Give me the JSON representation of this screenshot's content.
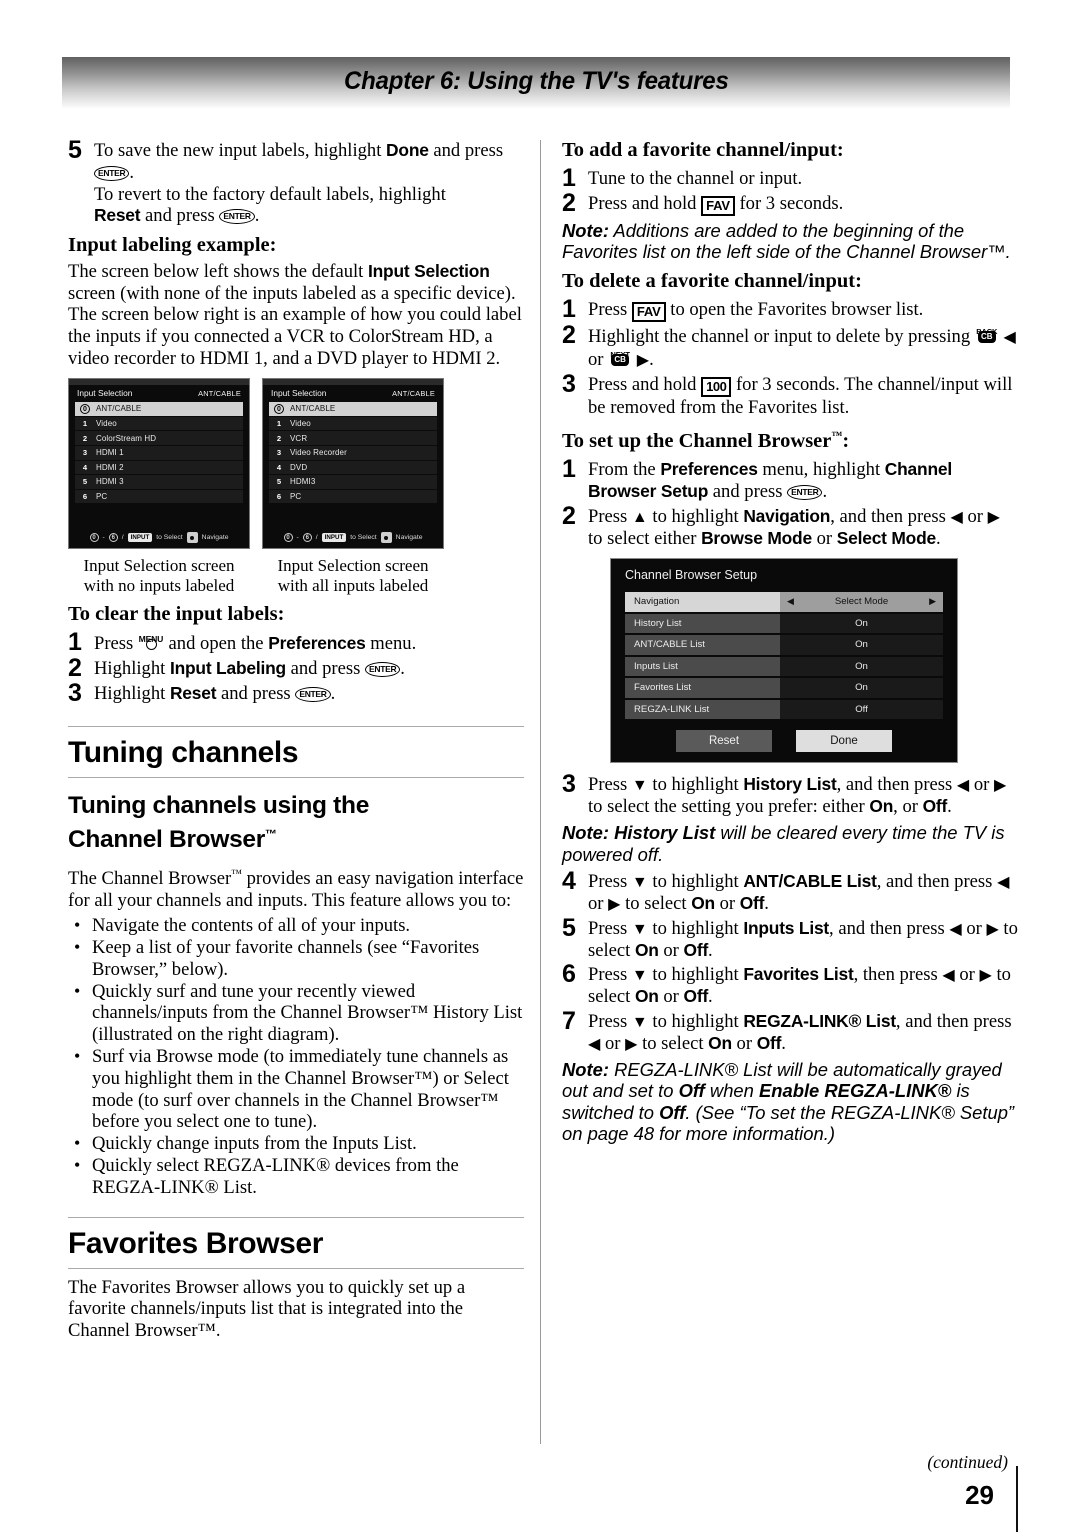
{
  "header": {
    "chapter_title": "Chapter 6: Using the TV's features"
  },
  "footer": {
    "continued": "(continued)",
    "page_number": "29"
  },
  "left_column": {
    "step5": {
      "num": "5",
      "line1_a": "To save the new input labels, highlight ",
      "line1_b": "Done",
      "line1_c": " and press ",
      "enter_key": "ENTER",
      "line2_a": "To revert to the factory default labels, highlight ",
      "line2_b": "Reset",
      "line2_c": " and press "
    },
    "input_labeling_example_heading": "Input labeling example:",
    "example_paragraph_a": "The screen below left shows the default ",
    "example_paragraph_b": "Input Selection",
    "example_paragraph_c": " screen (with none of the inputs labeled as a specific device). The screen below right is an example of how you could label the inputs if you connected a VCR to ColorStream HD, a video recorder to HDMI 1, and a DVD player to HDMI 2.",
    "osd_left": {
      "title": "Input Selection",
      "title_right": "ANT/CABLE",
      "items": [
        {
          "num": "0",
          "label": "ANT/CABLE",
          "selected": true
        },
        {
          "num": "1",
          "label": "Video",
          "selected": false
        },
        {
          "num": "2",
          "label": "ColorStream HD",
          "selected": false
        },
        {
          "num": "3",
          "label": "HDMI 1",
          "selected": false
        },
        {
          "num": "4",
          "label": "HDMI 2",
          "selected": false
        },
        {
          "num": "5",
          "label": "HDMI 3",
          "selected": false
        },
        {
          "num": "6",
          "label": "PC",
          "selected": false
        }
      ],
      "footer": {
        "range_from": "0",
        "dash": "-",
        "range_to": "6",
        "slash": "/",
        "input_key": "INPUT",
        "to_select": "to Select",
        "navigate": "Navigate"
      },
      "caption": "Input Selection screen with no inputs labeled"
    },
    "osd_right": {
      "title": "Input Selection",
      "title_right": "ANT/CABLE",
      "items": [
        {
          "num": "0",
          "label": "ANT/CABLE",
          "selected": true
        },
        {
          "num": "1",
          "label": "Video",
          "selected": false
        },
        {
          "num": "2",
          "label": "VCR",
          "selected": false
        },
        {
          "num": "3",
          "label": "Video Recorder",
          "selected": false
        },
        {
          "num": "4",
          "label": "DVD",
          "selected": false
        },
        {
          "num": "5",
          "label": "HDMI3",
          "selected": false
        },
        {
          "num": "6",
          "label": "PC",
          "selected": false
        }
      ],
      "footer": {
        "range_from": "0",
        "dash": "-",
        "range_to": "6",
        "slash": "/",
        "input_key": "INPUT",
        "to_select": "to Select",
        "navigate": "Navigate"
      },
      "caption": "Input Selection screen with all inputs labeled"
    },
    "clear_labels_heading": "To clear the input labels:",
    "clear_steps": {
      "s1_num": "1",
      "s1_a": "Press ",
      "s1_menu": "MENU",
      "s1_b": " and open the ",
      "s1_c": "Preferences",
      "s1_d": " menu.",
      "s2_num": "2",
      "s2_a": "Highlight ",
      "s2_b": "Input Labeling",
      "s2_c": " and press ",
      "s3_num": "3",
      "s3_a": "Highlight ",
      "s3_b": "Reset",
      "s3_c": " and press "
    },
    "tuning_channels_heading": "Tuning channels",
    "tuning_sub_heading_line1": "Tuning channels using the",
    "tuning_sub_heading_line2": "Channel Browser",
    "tm": "™",
    "cb_intro_a": "The Channel Browser",
    "cb_intro_b": " provides an easy navigation interface for all your channels and inputs. This feature allows you to:",
    "bullets": [
      {
        "text": "Navigate the contents of all of your inputs."
      },
      {
        "text": "Keep a list of your favorite channels (see “Favorites Browser,” below)."
      },
      {
        "text": "Quickly surf and tune your recently viewed channels/inputs from the Channel Browser™ History List (illustrated on the right diagram)."
      },
      {
        "text": "Surf via Browse mode (to immediately tune channels as you highlight them in the Channel Browser™) or Select mode (to surf over channels in the Channel Browser™ before you select one to tune)."
      },
      {
        "text": "Quickly change inputs from the Inputs List."
      },
      {
        "text": "Quickly select REGZA-LINK® devices from the REGZA-LINK® List."
      }
    ],
    "favorites_browser_heading": "Favorites Browser",
    "favorites_browser_text": "The Favorites Browser allows you to quickly set up a favorite channels/inputs list that is integrated into the Channel Browser™."
  },
  "right_column": {
    "add_fav_heading": "To add a favorite channel/input:",
    "add_fav_steps": {
      "s1_num": "1",
      "s1_text": "Tune to the channel or input.",
      "s2_num": "2",
      "s2_a": "Press and hold ",
      "s2_key": "FAV",
      "s2_b": " for 3 seconds."
    },
    "note1_label": "Note:",
    "note1_text": " Additions are added to the beginning of the Favorites list on the left side of the Channel Browser™.",
    "delete_fav_heading": "To delete a favorite channel/input:",
    "delete_fav_steps": {
      "s1_num": "1",
      "s1_a": "Press ",
      "s1_key": "FAV",
      "s1_b": " to open the Favorites browser list.",
      "s2_num": "2",
      "s2_a": "Highlight the channel or input to delete by pressing ",
      "s2_back": "BACK",
      "s2_cb": "CB",
      "s2_or": " or ",
      "s2_next": "NEXT",
      "s3_num": "3",
      "s3_a": "Press and hold ",
      "s3_key": "100",
      "s3_b": " for 3 seconds. The channel/input will be removed from the Favorites list."
    },
    "setup_cb_heading_a": "To set up the Channel Browser",
    "setup_cb_heading_b": ":",
    "setup_steps_12": {
      "s1_num": "1",
      "s1_a": "From the ",
      "s1_b": "Preferences",
      "s1_c": " menu, highlight ",
      "s1_d": "Channel Browser Setup",
      "s1_e": " and press ",
      "s2_num": "2",
      "s2_a": "Press ",
      "s2_up": "▲",
      "s2_b": " to highlight ",
      "s2_c": "Navigation",
      "s2_d": ", and then press ",
      "s2_left": "◀",
      "s2_e": " or ",
      "s2_right": "▶",
      "s2_f": " to select either ",
      "s2_g": "Browse Mode",
      "s2_h": " or ",
      "s2_i": "Select Mode",
      "s2_j": "."
    },
    "cbs_osd": {
      "title": "Channel Browser Setup",
      "rows": [
        {
          "name": "Navigation",
          "value": "Select Mode",
          "highlighted": true,
          "arrows": true
        },
        {
          "name": "History List",
          "value": "On",
          "highlighted": false,
          "arrows": false
        },
        {
          "name": "ANT/CABLE List",
          "value": "On",
          "highlighted": false,
          "arrows": false
        },
        {
          "name": "Inputs List",
          "value": "On",
          "highlighted": false,
          "arrows": false
        },
        {
          "name": "Favorites List",
          "value": "On",
          "highlighted": false,
          "arrows": false
        },
        {
          "name": "REGZA-LINK List",
          "value": "Off",
          "highlighted": false,
          "arrows": false
        }
      ],
      "reset_button": "Reset",
      "done_button": "Done",
      "arrow_left": "◀",
      "arrow_right": "▶"
    },
    "step3": {
      "num": "3",
      "a": "Press ",
      "down": "▼",
      "b": " to highlight ",
      "c": "History List",
      "d": ", and then press ",
      "left": "◀",
      "e": " or ",
      "right": "▶",
      "f": " to select the setting you prefer: either ",
      "g": "On",
      "h": ", or ",
      "i": "Off",
      "j": "."
    },
    "note2_label": "Note: ",
    "note2_bold": "History List",
    "note2_text": " will be cleared every time the TV is powered off.",
    "step4": {
      "num": "4",
      "a": "Press ",
      "down": "▼",
      "b": " to highlight ",
      "c": "ANT/CABLE List",
      "d": ", and then press ",
      "left": "◀",
      "e": " or ",
      "right": "▶",
      "f": " to select ",
      "g": "On",
      "h": " or ",
      "i": "Off",
      "j": "."
    },
    "step5": {
      "num": "5",
      "a": "Press ",
      "down": "▼",
      "b": " to highlight ",
      "c": "Inputs List",
      "d": ", and then press ",
      "left": "◀",
      "e": " or ",
      "right": "▶",
      "f": " to select ",
      "g": "On",
      "h": " or ",
      "i": "Off",
      "j": "."
    },
    "step6": {
      "num": "6",
      "a": "Press ",
      "down": "▼",
      "b": " to highlight ",
      "c": "Favorites List",
      "d": ", then press ",
      "left": "◀",
      "e": " or ",
      "right": "▶",
      "f": " to select ",
      "g": "On",
      "h": " or ",
      "i": "Off",
      "j": "."
    },
    "step7": {
      "num": "7",
      "a": "Press ",
      "down": "▼",
      "b": " to highlight ",
      "c": "REGZA-LINK® List",
      "d": ", and then press ",
      "left": "◀",
      "e": " or ",
      "right": "▶",
      "f": " to select ",
      "g": "On",
      "h": " or ",
      "i": "Off",
      "j": "."
    },
    "note3": {
      "label": "Note: ",
      "t1": "REGZA-LINK® List will be automatically grayed out and set to ",
      "b1": "Off",
      "t2": " when ",
      "b2": "Enable REGZA-LINK®",
      "t3": " is switched to ",
      "b3": "Off",
      "t4": ". (See “To set the REGZA-LINK® Setup” on page 48 for more information.)"
    }
  }
}
